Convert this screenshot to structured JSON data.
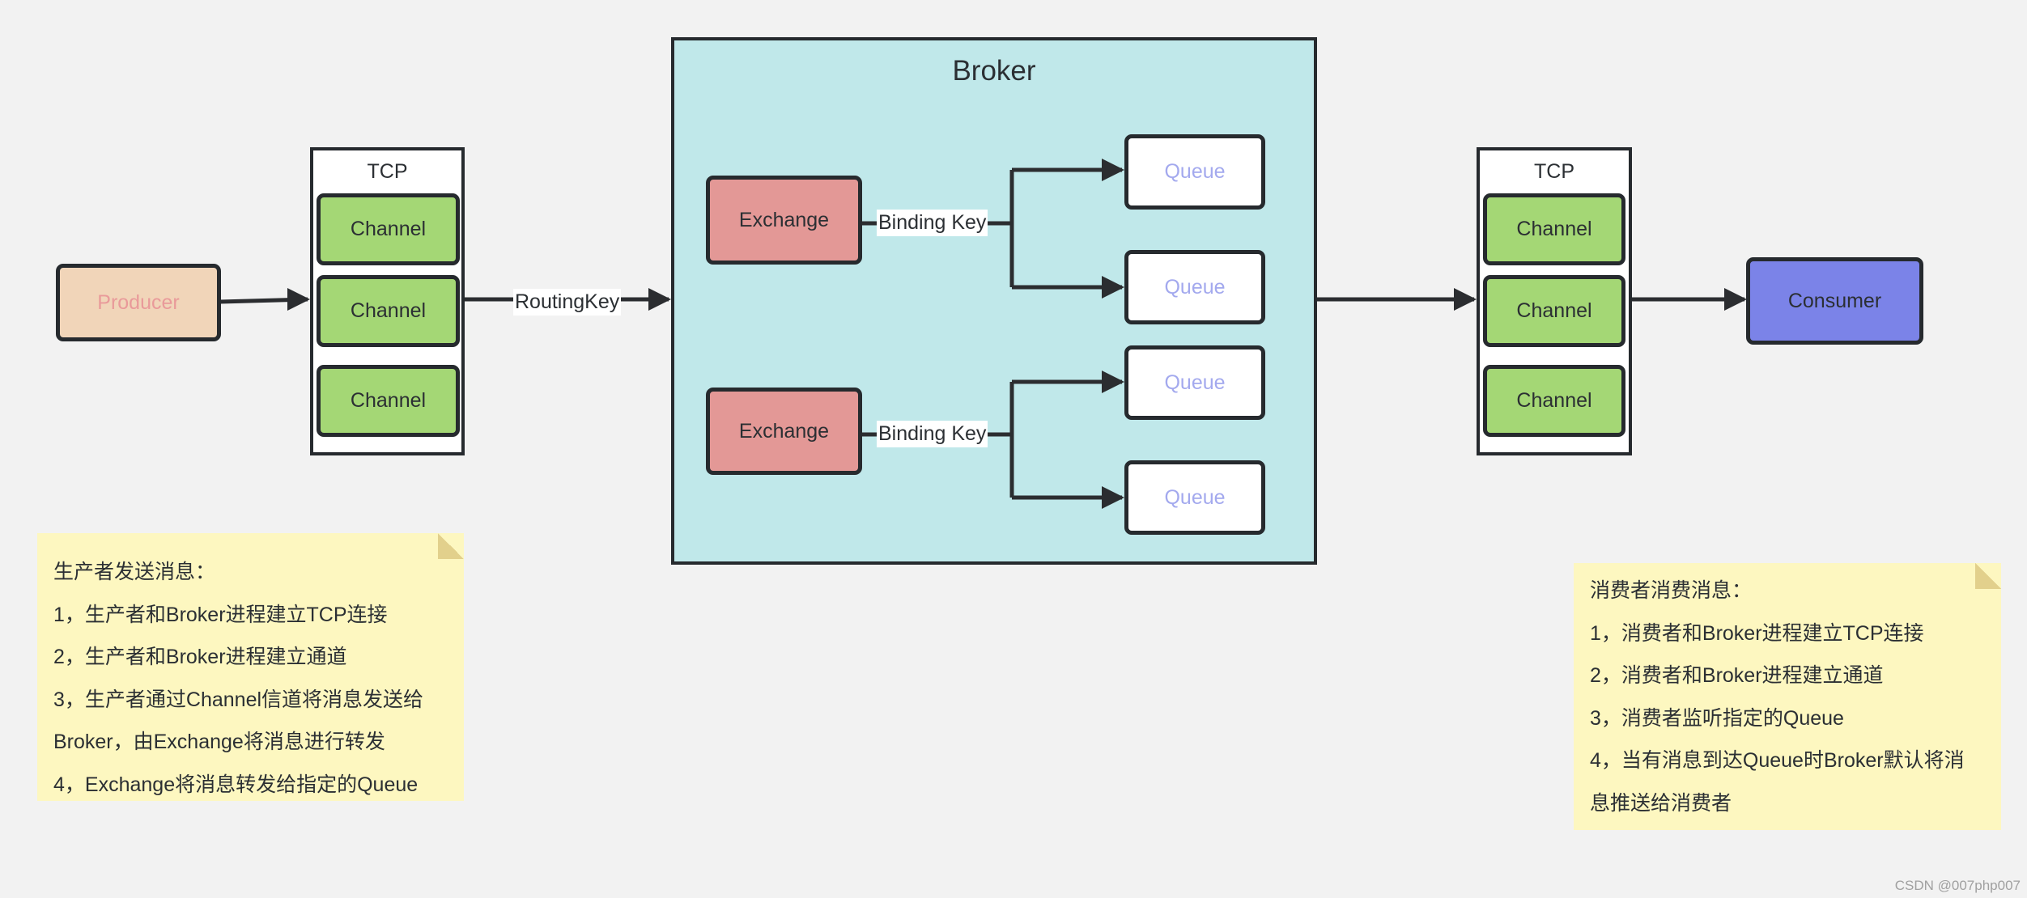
{
  "colors": {
    "background": "#f2f2f2",
    "producer": "#f1d5b9",
    "producer_text": "#e99a9a",
    "channel": "#a4d775",
    "broker": "#c0e8ea",
    "exchange": "#e39896",
    "queue_text": "#a3a9ee",
    "consumer": "#7b83e8",
    "note": "#fdf7c0"
  },
  "producer": {
    "label": "Producer"
  },
  "left_tcp": {
    "title": "TCP",
    "channels": [
      "Channel",
      "Channel",
      "Channel"
    ]
  },
  "routing_key": "RoutingKey",
  "broker": {
    "title": "Broker",
    "exchanges": [
      {
        "label": "Exchange",
        "binding": "Binding Key",
        "queues": [
          "Queue",
          "Queue"
        ]
      },
      {
        "label": "Exchange",
        "binding": "Binding Key",
        "queues": [
          "Queue",
          "Queue"
        ]
      }
    ]
  },
  "right_tcp": {
    "title": "TCP",
    "channels": [
      "Channel",
      "Channel",
      "Channel"
    ]
  },
  "consumer": {
    "label": "Consumer"
  },
  "producer_note": {
    "title": "生产者发送消息：",
    "lines": [
      "1，生产者和Broker进程建立TCP连接",
      "2，生产者和Broker进程建立通道",
      "3，生产者通过Channel信道将消息发送给",
      "Broker，由Exchange将消息进行转发",
      "4，Exchange将消息转发给指定的Queue"
    ]
  },
  "consumer_note": {
    "title": "消费者消费消息：",
    "lines": [
      "1，消费者和Broker进程建立TCP连接",
      "2，消费者和Broker进程建立通道",
      "3，消费者监听指定的Queue",
      "4，当有消息到达Queue时Broker默认将消",
      "息推送给消费者"
    ]
  },
  "watermark": "CSDN @007php007"
}
